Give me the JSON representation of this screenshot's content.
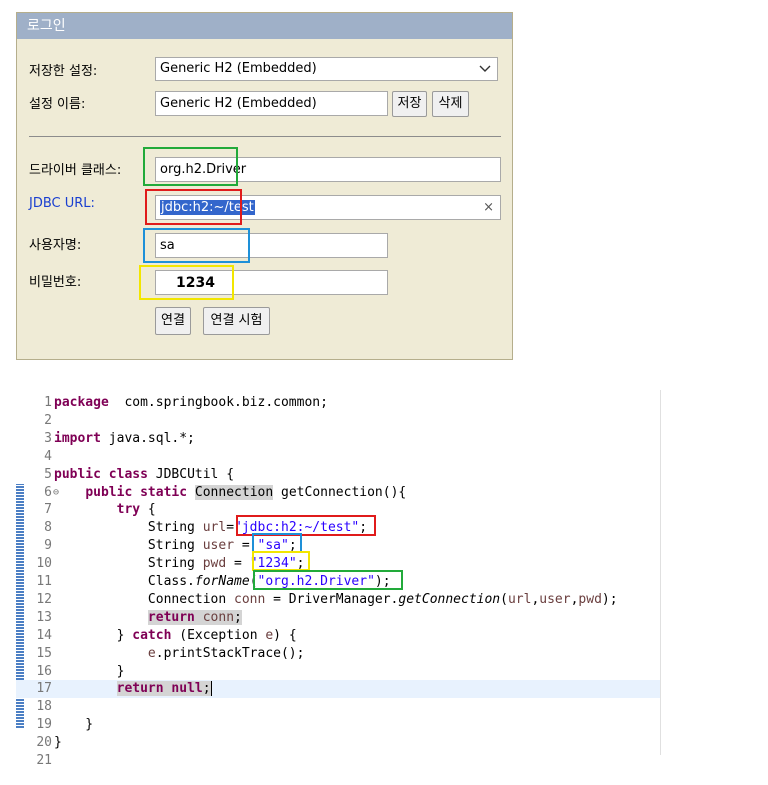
{
  "login": {
    "title": "로그인",
    "saved_settings_label": "저장한 설정:",
    "saved_settings_value": "Generic H2 (Embedded)",
    "setting_name_label": "설정 이름:",
    "setting_name_value": "Generic H2 (Embedded)",
    "save_button": "저장",
    "delete_button": "삭제",
    "driver_class_label": "드라이버 클래스:",
    "driver_class_value": "org.h2.Driver",
    "jdbc_url_label": "JDBC URL:",
    "jdbc_url_value": "jdbc:h2:~/test",
    "clear_symbol": "×",
    "username_label": "사용자명:",
    "username_value": "sa",
    "password_label": "비밀번호:",
    "password_value": "1234",
    "connect_button": "연결",
    "test_connection_button": "연결 시험",
    "dropdown_arrow_icon": "chevron-down-icon",
    "highlight_colors": {
      "driver": "#22aa3a",
      "url": "#e01b1b",
      "user": "#1e90d8",
      "password": "#f2e600"
    }
  },
  "code": {
    "lines": [
      {
        "n": "1",
        "parts": [
          [
            "kw",
            "package"
          ],
          [
            "",
            "  com.springbook.biz.common;"
          ]
        ]
      },
      {
        "n": "2",
        "parts": []
      },
      {
        "n": "3",
        "parts": [
          [
            "kw",
            "import"
          ],
          [
            "",
            " java.sql.*;"
          ]
        ]
      },
      {
        "n": "4",
        "parts": []
      },
      {
        "n": "5",
        "parts": [
          [
            "kw",
            "public"
          ],
          [
            "",
            " "
          ],
          [
            "kw",
            "class"
          ],
          [
            "",
            " JDBCUtil {"
          ]
        ]
      },
      {
        "n": "6",
        "fold": "⊖",
        "parts": [
          [
            "",
            "    "
          ],
          [
            "kw",
            "public"
          ],
          [
            "",
            " "
          ],
          [
            "kw",
            "static"
          ],
          [
            "",
            " "
          ],
          [
            "mark",
            "Connection"
          ],
          [
            "",
            " getConnection(){"
          ]
        ]
      },
      {
        "n": "7",
        "parts": [
          [
            "",
            "        "
          ],
          [
            "kw",
            "try"
          ],
          [
            "",
            " {"
          ]
        ]
      },
      {
        "n": "8",
        "parts": [
          [
            "",
            "            String "
          ],
          [
            "var",
            "url"
          ],
          [
            "",
            "="
          ],
          [
            "str",
            "\"jdbc:h2:~/test\""
          ],
          [
            "",
            ";"
          ]
        ]
      },
      {
        "n": "9",
        "parts": [
          [
            "",
            "            String "
          ],
          [
            "var",
            "user"
          ],
          [
            "",
            " = "
          ],
          [
            "str",
            "\"sa\""
          ],
          [
            "",
            ";"
          ]
        ]
      },
      {
        "n": "10",
        "parts": [
          [
            "",
            "            String "
          ],
          [
            "var",
            "pwd"
          ],
          [
            "",
            " = "
          ],
          [
            "str",
            "\"1234\""
          ],
          [
            "",
            ";"
          ]
        ]
      },
      {
        "n": "11",
        "parts": [
          [
            "",
            "            Class."
          ],
          [
            "it",
            "forName"
          ],
          [
            "",
            "("
          ],
          [
            "str",
            "\"org.h2.Driver\""
          ],
          [
            "",
            ");"
          ]
        ]
      },
      {
        "n": "12",
        "parts": [
          [
            "",
            "            Connection "
          ],
          [
            "var",
            "conn"
          ],
          [
            "",
            " = DriverManager."
          ],
          [
            "it",
            "getConnection"
          ],
          [
            "",
            "("
          ],
          [
            "var",
            "url"
          ],
          [
            "",
            ","
          ],
          [
            "var",
            "user"
          ],
          [
            "",
            ","
          ],
          [
            "var",
            "pwd"
          ],
          [
            "",
            ");"
          ]
        ]
      },
      {
        "n": "13",
        "parts": [
          [
            "",
            "            "
          ],
          [
            "kwmark",
            "return"
          ],
          [
            "mark",
            " "
          ],
          [
            "varmark",
            "conn"
          ],
          [
            "mark",
            ";"
          ]
        ]
      },
      {
        "n": "14",
        "parts": [
          [
            "",
            "        } "
          ],
          [
            "kw",
            "catch"
          ],
          [
            "",
            " (Exception "
          ],
          [
            "var",
            "e"
          ],
          [
            "",
            ") {"
          ]
        ]
      },
      {
        "n": "15",
        "parts": [
          [
            "",
            "            "
          ],
          [
            "var",
            "e"
          ],
          [
            "",
            ".printStackTrace();"
          ]
        ]
      },
      {
        "n": "16",
        "parts": [
          [
            "",
            "        }"
          ]
        ]
      },
      {
        "n": "17",
        "current": true,
        "parts": [
          [
            "",
            "        "
          ],
          [
            "kwmark",
            "return"
          ],
          [
            "mark",
            " "
          ],
          [
            "kwmark",
            "null"
          ],
          [
            "mark",
            ";"
          ],
          [
            "caret",
            ""
          ]
        ]
      },
      {
        "n": "18",
        "parts": []
      },
      {
        "n": "19",
        "parts": [
          [
            "",
            "    }"
          ]
        ]
      },
      {
        "n": "20",
        "parts": [
          [
            "",
            "}"
          ]
        ]
      },
      {
        "n": "21",
        "parts": []
      }
    ],
    "highlight_colors": {
      "url": "#e01b1b",
      "user": "#1e90d8",
      "password": "#f2e600",
      "driver": "#22aa3a"
    }
  }
}
